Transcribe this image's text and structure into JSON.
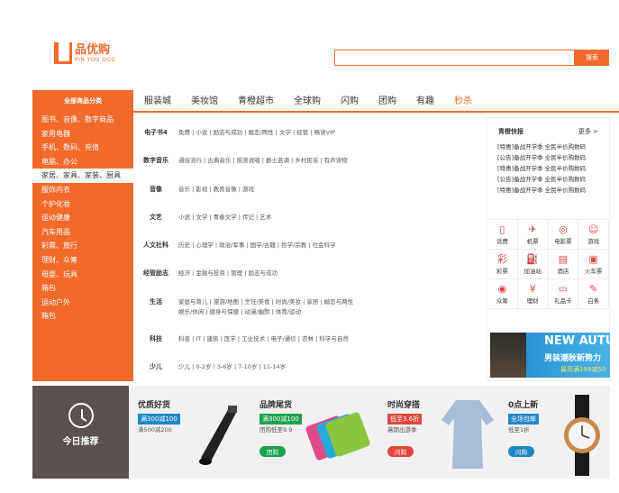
{
  "logo": {
    "brand": "品优购",
    "sub": "PIN YOU GOU"
  },
  "search": {
    "button": "搜索",
    "placeholder": ""
  },
  "nav": {
    "all_categories": "全部商品分类",
    "tabs": [
      "服装城",
      "美妆馆",
      "青橙超市",
      "全球购",
      "闪购",
      "团购",
      "有趣",
      "秒杀"
    ]
  },
  "sidebar": [
    "图书、音像、数字商品",
    "家用电器",
    "手机、数码、充值",
    "电脑、办公",
    "家居、家具、家装、厨具",
    "服饰内衣",
    "个护化妆",
    "运动健康",
    "汽车用品",
    "彩票、旅行",
    "理财、众筹",
    "母婴、玩具",
    "箱包",
    "运动户外",
    "箱包"
  ],
  "menu": [
    {
      "h": "电子书4",
      "l": "免费 | 小说 | 励志与成功 | 婚恋/两性 | 文学 | 经管 | 畅读VIP"
    },
    {
      "h": "数字音乐",
      "l": "通俗流行 | 古典音乐 | 摇滚说唱 | 爵士蓝调 | 乡村民谣 | 有声读物"
    },
    {
      "h": "音像",
      "l": "音乐 | 影视 | 教育音像 | 游戏"
    },
    {
      "h": "文艺",
      "l": "小说 | 文学 | 青春文学 | 传记 | 艺术"
    },
    {
      "h": "人文社科",
      "l": "历史 | 心理学 | 政治/军事 | 国学/古籍 | 哲学/宗教 | 社会科学"
    },
    {
      "h": "经管励志",
      "l": "经济 | 金融与投资 | 管理 | 励志与成功"
    },
    {
      "h": "生活",
      "l": "家庭与育儿 | 旅游/地图 | 烹饪/美食 | 时尚/美妆 | 家居 | 婚恋与两性",
      "l2": "娱乐/休闲 | 健身与保健 | 动漫/幽默 | 体育/运动"
    },
    {
      "h": "科技",
      "l": "科普 | IT | 建筑 | 医学 | 工业技术 | 电子/通信 | 农林 | 科学与自然"
    },
    {
      "h": "少儿",
      "l": "少儿 | 0-2岁 | 3-6岁 | 7-10岁 | 11-14岁"
    }
  ],
  "news": {
    "title": "青橙快报",
    "more": "更多 >",
    "items": [
      "[特惠]备战开学季 全民半价购数码",
      "[公告]备战开学季 全民半价购数码",
      "[特惠]备战开学季 全民半价购数码",
      "[公告]备战开学季 全民半价购数码",
      "[特惠]备战开学季 全民半价购数码"
    ]
  },
  "services": [
    {
      "label": "话费",
      "icon": "phone-icon",
      "g": "▯"
    },
    {
      "label": "机票",
      "icon": "plane-icon",
      "g": "✈"
    },
    {
      "label": "电影票",
      "icon": "film-icon",
      "g": "◎"
    },
    {
      "label": "游戏",
      "icon": "game-icon",
      "g": "☺"
    },
    {
      "label": "彩票",
      "icon": "lottery-icon",
      "g": "彩"
    },
    {
      "label": "加油站",
      "icon": "gas-icon",
      "g": "⛽"
    },
    {
      "label": "酒店",
      "icon": "hotel-icon",
      "g": "▤"
    },
    {
      "label": "火车票",
      "icon": "train-icon",
      "g": "▣"
    },
    {
      "label": "众筹",
      "icon": "crowdfund-icon",
      "g": "◉"
    },
    {
      "label": "理财",
      "icon": "finance-icon",
      "g": "¥"
    },
    {
      "label": "礼品卡",
      "icon": "gift-card-icon",
      "g": "▭"
    },
    {
      "label": "白条",
      "icon": "credit-icon",
      "g": "✎"
    }
  ],
  "banner": {
    "l1": "NEW AUTUMN",
    "l2": "男装潮秋新势力",
    "l3": "最高满199减50"
  },
  "recommend": {
    "title": "今日推荐"
  },
  "cards": [
    {
      "title": "优质好货",
      "tag": "满300减100",
      "sub": "满500减200",
      "btn": "",
      "tagColor": "#1e86c8"
    },
    {
      "title": "品牌尾货",
      "tag": "满300减100",
      "sub": "团购低至9.9",
      "btn": "团购",
      "tagColor": "#1aa34a"
    },
    {
      "title": "时尚穿搭",
      "tag": "低至3.6折",
      "sub": "暑期出游季",
      "btn": "闪购",
      "tagColor": "#e1473f"
    },
    {
      "title": "0点上新",
      "tag": "全场包邮",
      "sub": "低至1折",
      "btn": "闪购",
      "tagColor": "#1e86c8"
    }
  ],
  "colors": {
    "accent": "#f26a2b"
  }
}
